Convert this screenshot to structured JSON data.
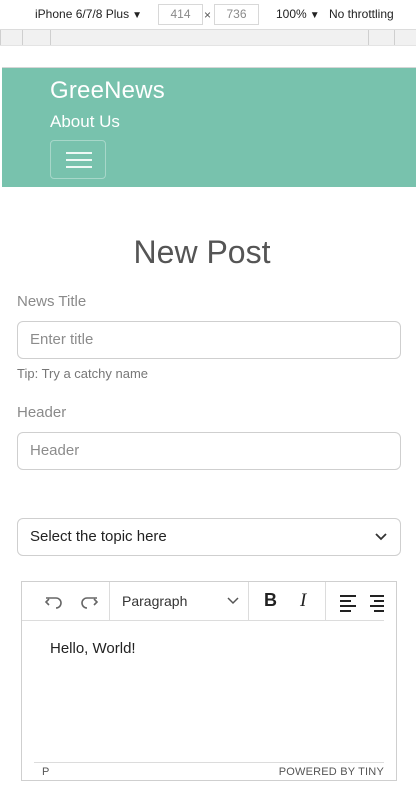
{
  "devtools": {
    "device": "iPhone 6/7/8 Plus",
    "width": "414",
    "height": "736",
    "times": "×",
    "zoom": "100%",
    "throttling": "No throttling",
    "caret": "▼"
  },
  "navbar": {
    "brand": "GreeNews",
    "link": "About Us",
    "color": "#78c2ad"
  },
  "form": {
    "title": "New Post",
    "news_title_label": "News Title",
    "news_title_placeholder": "Enter title",
    "tip": "Tip: Try a catchy name",
    "header_label": "Header",
    "header_placeholder": "Header",
    "topic_select": "Select the topic here"
  },
  "editor": {
    "block_format": "Paragraph",
    "bold": "B",
    "italic": "I",
    "content": "Hello, World!",
    "path": "P",
    "powered": "POWERED BY TINY"
  }
}
